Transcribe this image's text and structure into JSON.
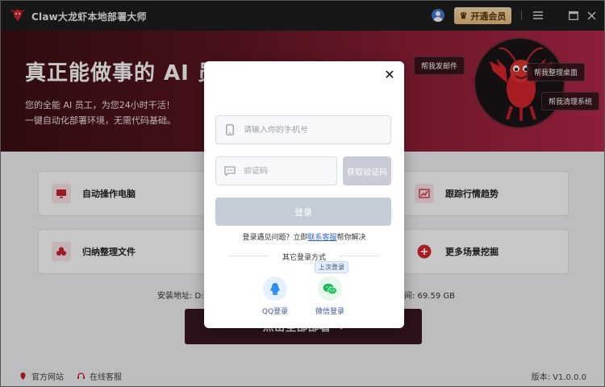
{
  "window": {
    "title": "Claw大龙虾本地部署大师",
    "vip_label": "开通会员"
  },
  "banner": {
    "title": "真正能做事的 AI 员工",
    "subtitle1": "您的全能 AI 员工，为您24小时干活！",
    "subtitle2": "一键自动化部署环境，无需代码基础。",
    "bubbles": [
      "帮我发邮件",
      "帮我整理桌面",
      "帮我清理系统"
    ]
  },
  "features": [
    {
      "label": "自动操作电脑",
      "icon": "monitor-icon"
    },
    {
      "label": "跟踪行情趋势",
      "icon": "trend-icon"
    },
    {
      "label": "归纳整理文件",
      "icon": "files-icon"
    },
    {
      "label": "更多场景挖掘",
      "icon": "plus-icon"
    }
  ],
  "install": {
    "path_label": "安装地址: D:\\",
    "disk_label": "间: 69.59 GB"
  },
  "deploy_label": "点击全部部署 →",
  "footer": {
    "website": "官方网站",
    "support": "在线客服",
    "version": "版本: V1.0.0.0"
  },
  "login": {
    "phone_placeholder": "请输入你的手机号",
    "code_placeholder": "验证码",
    "get_code": "获取验证码",
    "submit": "登录",
    "help_prefix": "登录遇见问题？立即",
    "help_link": "联系客服",
    "help_suffix": "帮你解决",
    "other_methods": "其它登录方式",
    "last_used": "上次登录",
    "qq_label": "QQ登录",
    "wechat_label": "微信登录"
  },
  "colors": {
    "accent_red": "#c8202e",
    "vip_gold": "#e9be7d",
    "link_blue": "#2a62d8",
    "wechat_green": "#1fb65a",
    "qq_blue": "#2f8ef0"
  }
}
